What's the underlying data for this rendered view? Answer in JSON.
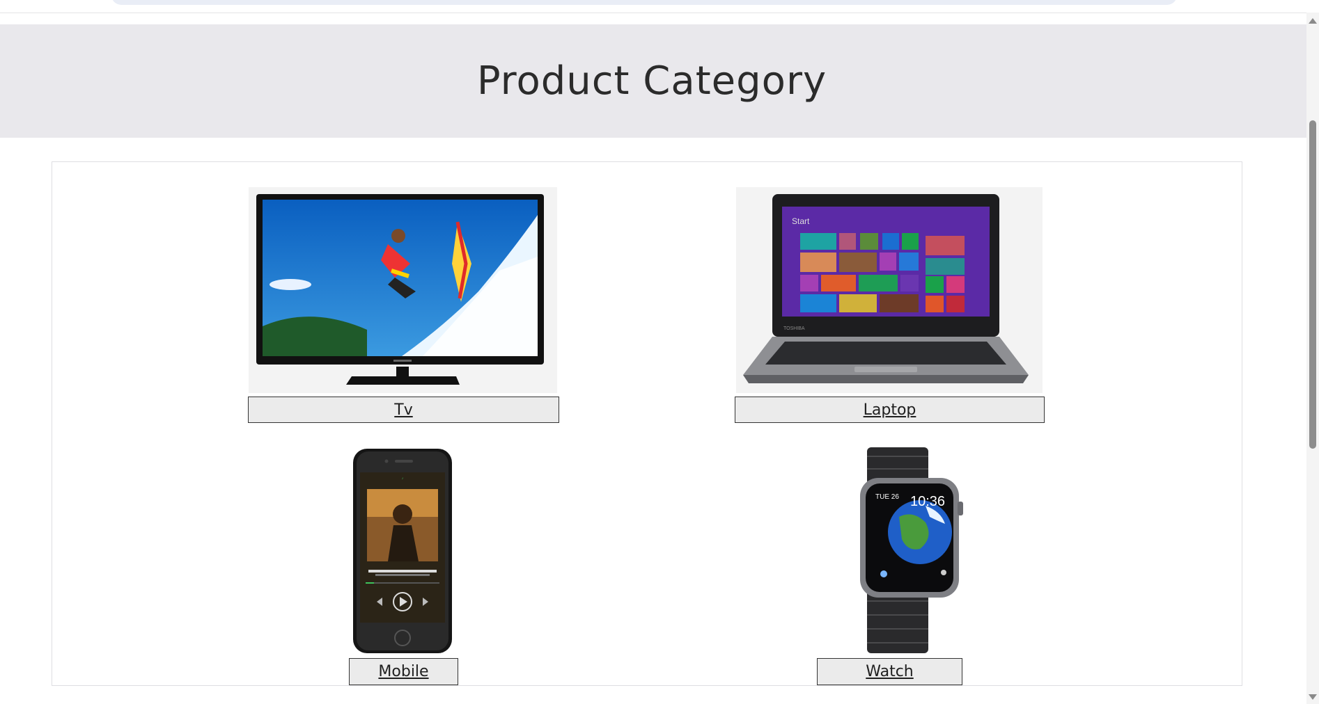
{
  "page": {
    "title": "Product Category"
  },
  "categories": [
    {
      "label": "Tv",
      "icon": "tv-product-image"
    },
    {
      "label": "Laptop",
      "icon": "laptop-product-image"
    },
    {
      "label": "Mobile",
      "icon": "mobile-product-image"
    },
    {
      "label": "Watch",
      "icon": "watch-product-image"
    }
  ],
  "laptop_screen": {
    "start_text": "Start",
    "brand": "TOSHIBA"
  },
  "watch_screen": {
    "date": "TUE 26",
    "time": "10:36"
  },
  "colors": {
    "banner_bg": "#e9e8ec",
    "button_bg": "#ebebeb",
    "laptop_screen": "#5b2aa6"
  }
}
